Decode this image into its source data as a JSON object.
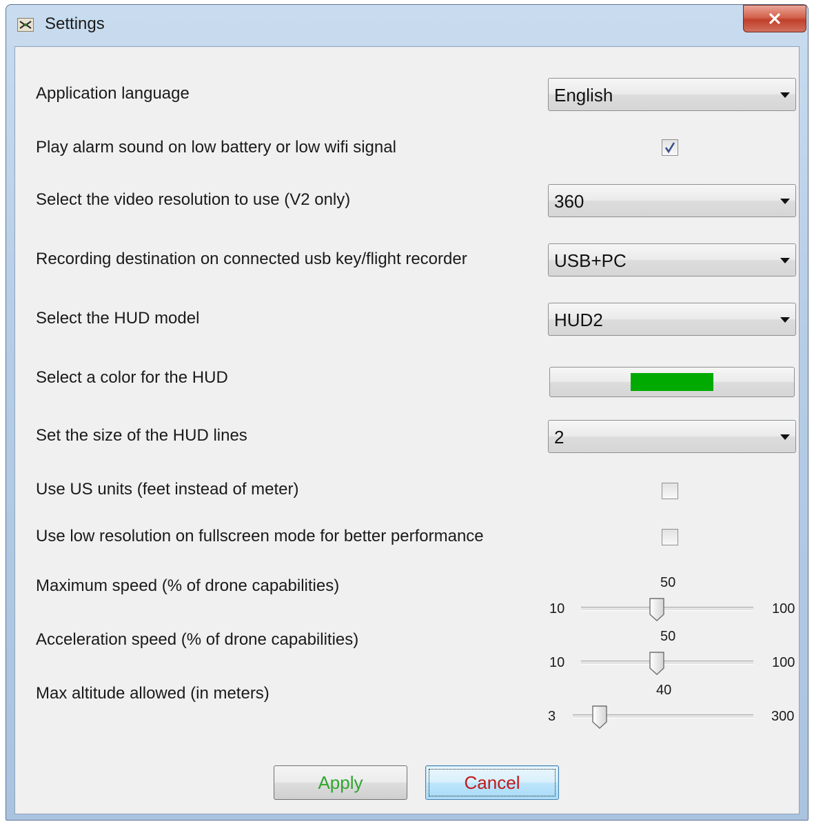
{
  "window": {
    "title": "Settings"
  },
  "settings": {
    "language": {
      "label": "Application language",
      "value": "English"
    },
    "alarm": {
      "label": "Play alarm sound on low battery or low wifi signal",
      "checked": true
    },
    "video_resolution": {
      "label": "Select the video resolution to use (V2 only)",
      "value": "360"
    },
    "recording_destination": {
      "label": "Recording destination on connected usb key/flight recorder",
      "value": "USB+PC"
    },
    "hud_model": {
      "label": "Select the HUD model",
      "value": "HUD2"
    },
    "hud_color": {
      "label": "Select a color for the HUD",
      "color": "#00aa00"
    },
    "hud_line_size": {
      "label": "Set the size of the HUD lines",
      "value": "2"
    },
    "us_units": {
      "label": "Use US units (feet instead of meter)",
      "checked": false
    },
    "low_res_fullscreen": {
      "label": "Use low resolution on fullscreen mode for better performance",
      "checked": false
    },
    "max_speed": {
      "label": "Maximum speed (% of drone capabilities)",
      "value": "50",
      "min": "10",
      "max": "100"
    },
    "acceleration": {
      "label": "Acceleration speed (% of drone capabilities)",
      "value": "50",
      "min": "10",
      "max": "100"
    },
    "max_altitude": {
      "label": "Max altitude allowed (in meters)",
      "value": "40",
      "min": "3",
      "max": "300"
    }
  },
  "buttons": {
    "apply": "Apply",
    "cancel": "Cancel"
  },
  "colors": {
    "apply_text": "#2fa52f",
    "cancel_text": "#c01818",
    "hud_color": "#00aa00"
  }
}
